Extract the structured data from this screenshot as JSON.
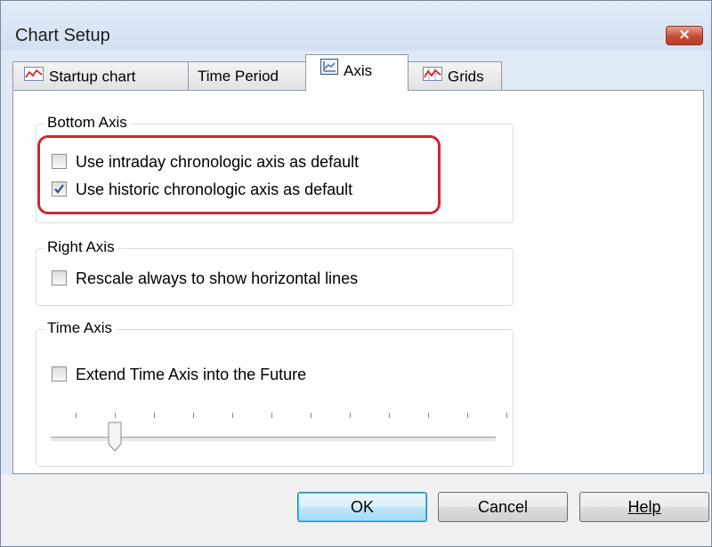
{
  "window": {
    "title": "Chart Setup",
    "close_glyph": "×",
    "close_icon": "close-icon"
  },
  "tabs": [
    {
      "label": "Startup chart",
      "icon": "line-chart-icon",
      "active": false
    },
    {
      "label": "Time Period",
      "icon": null,
      "active": false
    },
    {
      "label": "Axis",
      "icon": "axis-chart-icon",
      "active": true
    },
    {
      "label": "Grids",
      "icon": "grid-chart-icon",
      "active": false
    }
  ],
  "groups": {
    "bottom_axis": {
      "label": "Bottom Axis",
      "options": [
        {
          "label": "Use intraday chronologic axis as default",
          "checked": false
        },
        {
          "label": "Use historic chronologic axis as default",
          "checked": true
        }
      ]
    },
    "right_axis": {
      "label": "Right Axis",
      "options": [
        {
          "label": "Rescale always to show horizontal lines",
          "checked": false
        }
      ]
    },
    "time_axis": {
      "label": "Time Axis",
      "options": [
        {
          "label": "Extend Time Axis into the Future",
          "checked": false
        }
      ],
      "slider": {
        "ticks": 12,
        "position": 1
      }
    }
  },
  "buttons": {
    "ok": "OK",
    "cancel": "Cancel",
    "help": "Help"
  },
  "colors": {
    "highlight": "#c92a30",
    "accent": "#3c7fb1"
  }
}
